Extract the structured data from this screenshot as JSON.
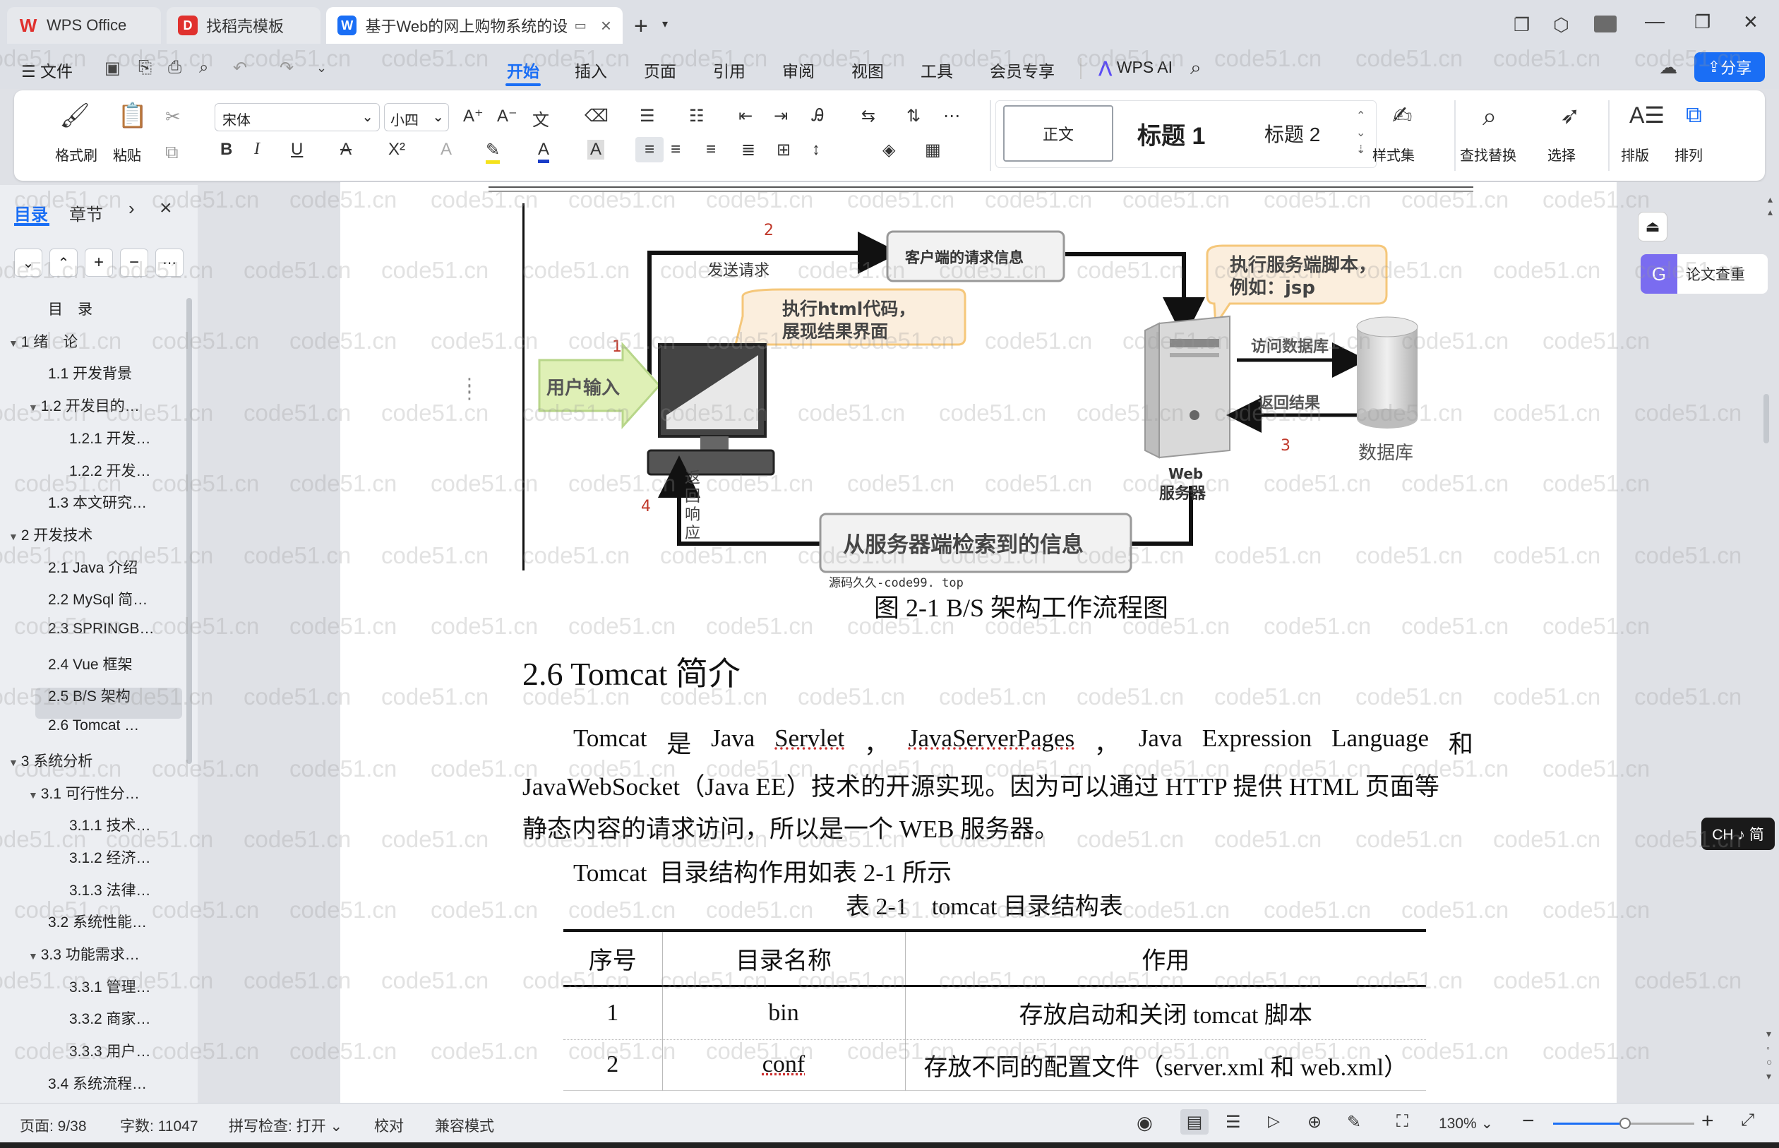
{
  "tabs": [
    {
      "label": "WPS Office"
    },
    {
      "label": "找稻壳模板"
    },
    {
      "label": "基于Web的网上购物系统的设"
    }
  ],
  "menu": {
    "file": "文件",
    "items": [
      "开始",
      "插入",
      "页面",
      "引用",
      "审阅",
      "视图",
      "工具",
      "会员专享"
    ],
    "ai": "WPS AI",
    "share": "分享"
  },
  "ribbon": {
    "format_painter": "格式刷",
    "paste": "粘贴",
    "font_name": "宋体",
    "font_size": "小四",
    "style_normal": "正文",
    "style_h1": "标题 1",
    "style_h2": "标题 2",
    "style_set": "样式集",
    "find_replace": "查找替换",
    "select": "选择",
    "layout": "排版",
    "arrange": "排列"
  },
  "panel": {
    "tab_toc": "目录",
    "tab_chapter": "章节"
  },
  "toc": [
    {
      "label": "目　录",
      "level": 1,
      "arrow": ""
    },
    {
      "label": "1 绪　论",
      "level": 0,
      "arrow": "▼"
    },
    {
      "label": "1.1 开发背景",
      "level": 1,
      "arrow": ""
    },
    {
      "label": "1.2 开发目的…",
      "level": 1,
      "arrow": "▼"
    },
    {
      "label": "1.2.1 开发…",
      "level": 2,
      "arrow": ""
    },
    {
      "label": "1.2.2 开发…",
      "level": 2,
      "arrow": ""
    },
    {
      "label": "1.3 本文研究…",
      "level": 1,
      "arrow": ""
    },
    {
      "label": "2 开发技术",
      "level": 0,
      "arrow": "▼"
    },
    {
      "label": "2.1 Java 介绍",
      "level": 1,
      "arrow": ""
    },
    {
      "label": "2.2 MySql 简…",
      "level": 1,
      "arrow": ""
    },
    {
      "label": "2.3 SPRINGB…",
      "level": 1,
      "arrow": ""
    },
    {
      "label": "2.4 Vue 框架",
      "level": 1,
      "arrow": ""
    },
    {
      "label": "2.5 B/S 架构",
      "level": 1,
      "arrow": "",
      "selected": true
    },
    {
      "label": "2.6 Tomcat …",
      "level": 1,
      "arrow": ""
    },
    {
      "label": "3 系统分析",
      "level": 0,
      "arrow": "▼"
    },
    {
      "label": "3.1 可行性分…",
      "level": 1,
      "arrow": "▼"
    },
    {
      "label": "3.1.1 技术…",
      "level": 2,
      "arrow": ""
    },
    {
      "label": "3.1.2 经济…",
      "level": 2,
      "arrow": ""
    },
    {
      "label": "3.1.3 法律…",
      "level": 2,
      "arrow": ""
    },
    {
      "label": "3.2 系统性能…",
      "level": 1,
      "arrow": ""
    },
    {
      "label": "3.3 功能需求…",
      "level": 1,
      "arrow": "▼"
    },
    {
      "label": "3.3.1 管理…",
      "level": 2,
      "arrow": ""
    },
    {
      "label": "3.3.2 商家…",
      "level": 2,
      "arrow": ""
    },
    {
      "label": "3.3.3 用户…",
      "level": 2,
      "arrow": ""
    },
    {
      "label": "3.4 系统流程…",
      "level": 1,
      "arrow": ""
    }
  ],
  "diagram": {
    "n1": "1",
    "n2": "2",
    "n3": "3",
    "n4": "4",
    "user_input": "用户输入",
    "send_request": "发送请求",
    "client_request": "客户端的请求信息",
    "exec_html_1": "执行html代码，",
    "exec_html_2": "展现结果界面",
    "exec_server_1": "执行服务端脚本，",
    "exec_server_2": "例如：jsp",
    "access_db": "访问数据库",
    "return_result": "返回结果",
    "database": "数据库",
    "web": "Web",
    "server": "服务器",
    "return_1": "返",
    "return_2": "回",
    "return_3": "响",
    "return_4": "应",
    "retrieved": "从服务器端检索到的信息",
    "source_tag": "源码久久-code99. top"
  },
  "doc": {
    "caption": "图 2-1 B/S 架构工作流程图",
    "heading": "2.6 Tomcat 简介",
    "p1_words": [
      "Tomcat",
      "是",
      "Java",
      "Servlet",
      "，",
      "JavaServerPages",
      "，",
      "Java",
      "Expression",
      "Language",
      "和"
    ],
    "p1_line2": "JavaWebSocket（Java EE）技术的开源实现。因为可以通过 HTTP 提供 HTML 页面等",
    "p1_line3": "静态内容的请求访问，所以是一个 WEB 服务器。",
    "p2": "Tomcat  目录结构作用如表 2-1 所示",
    "table_caption": "表 2-1　tomcat 目录结构表",
    "table_headers": [
      "序号",
      "目录名称",
      "作用"
    ],
    "table_rows": [
      [
        "1",
        "bin",
        "存放启动和关闭 tomcat 脚本"
      ],
      [
        "2",
        "conf",
        "存放不同的配置文件（server.xml 和 web.xml）"
      ]
    ]
  },
  "right": {
    "plagiarism": "论文查重",
    "ime": "CH ♪ 简"
  },
  "status": {
    "page": "页面: 9/38",
    "words": "字数: 11047",
    "spell": "拼写检查: 打开",
    "proof": "校对",
    "compat": "兼容模式",
    "zoom": "130%"
  },
  "watermark": "code51.cn",
  "colors": {
    "accent": "#1a6ef5",
    "wps_red": "#e0312e",
    "table_line": "#111"
  }
}
